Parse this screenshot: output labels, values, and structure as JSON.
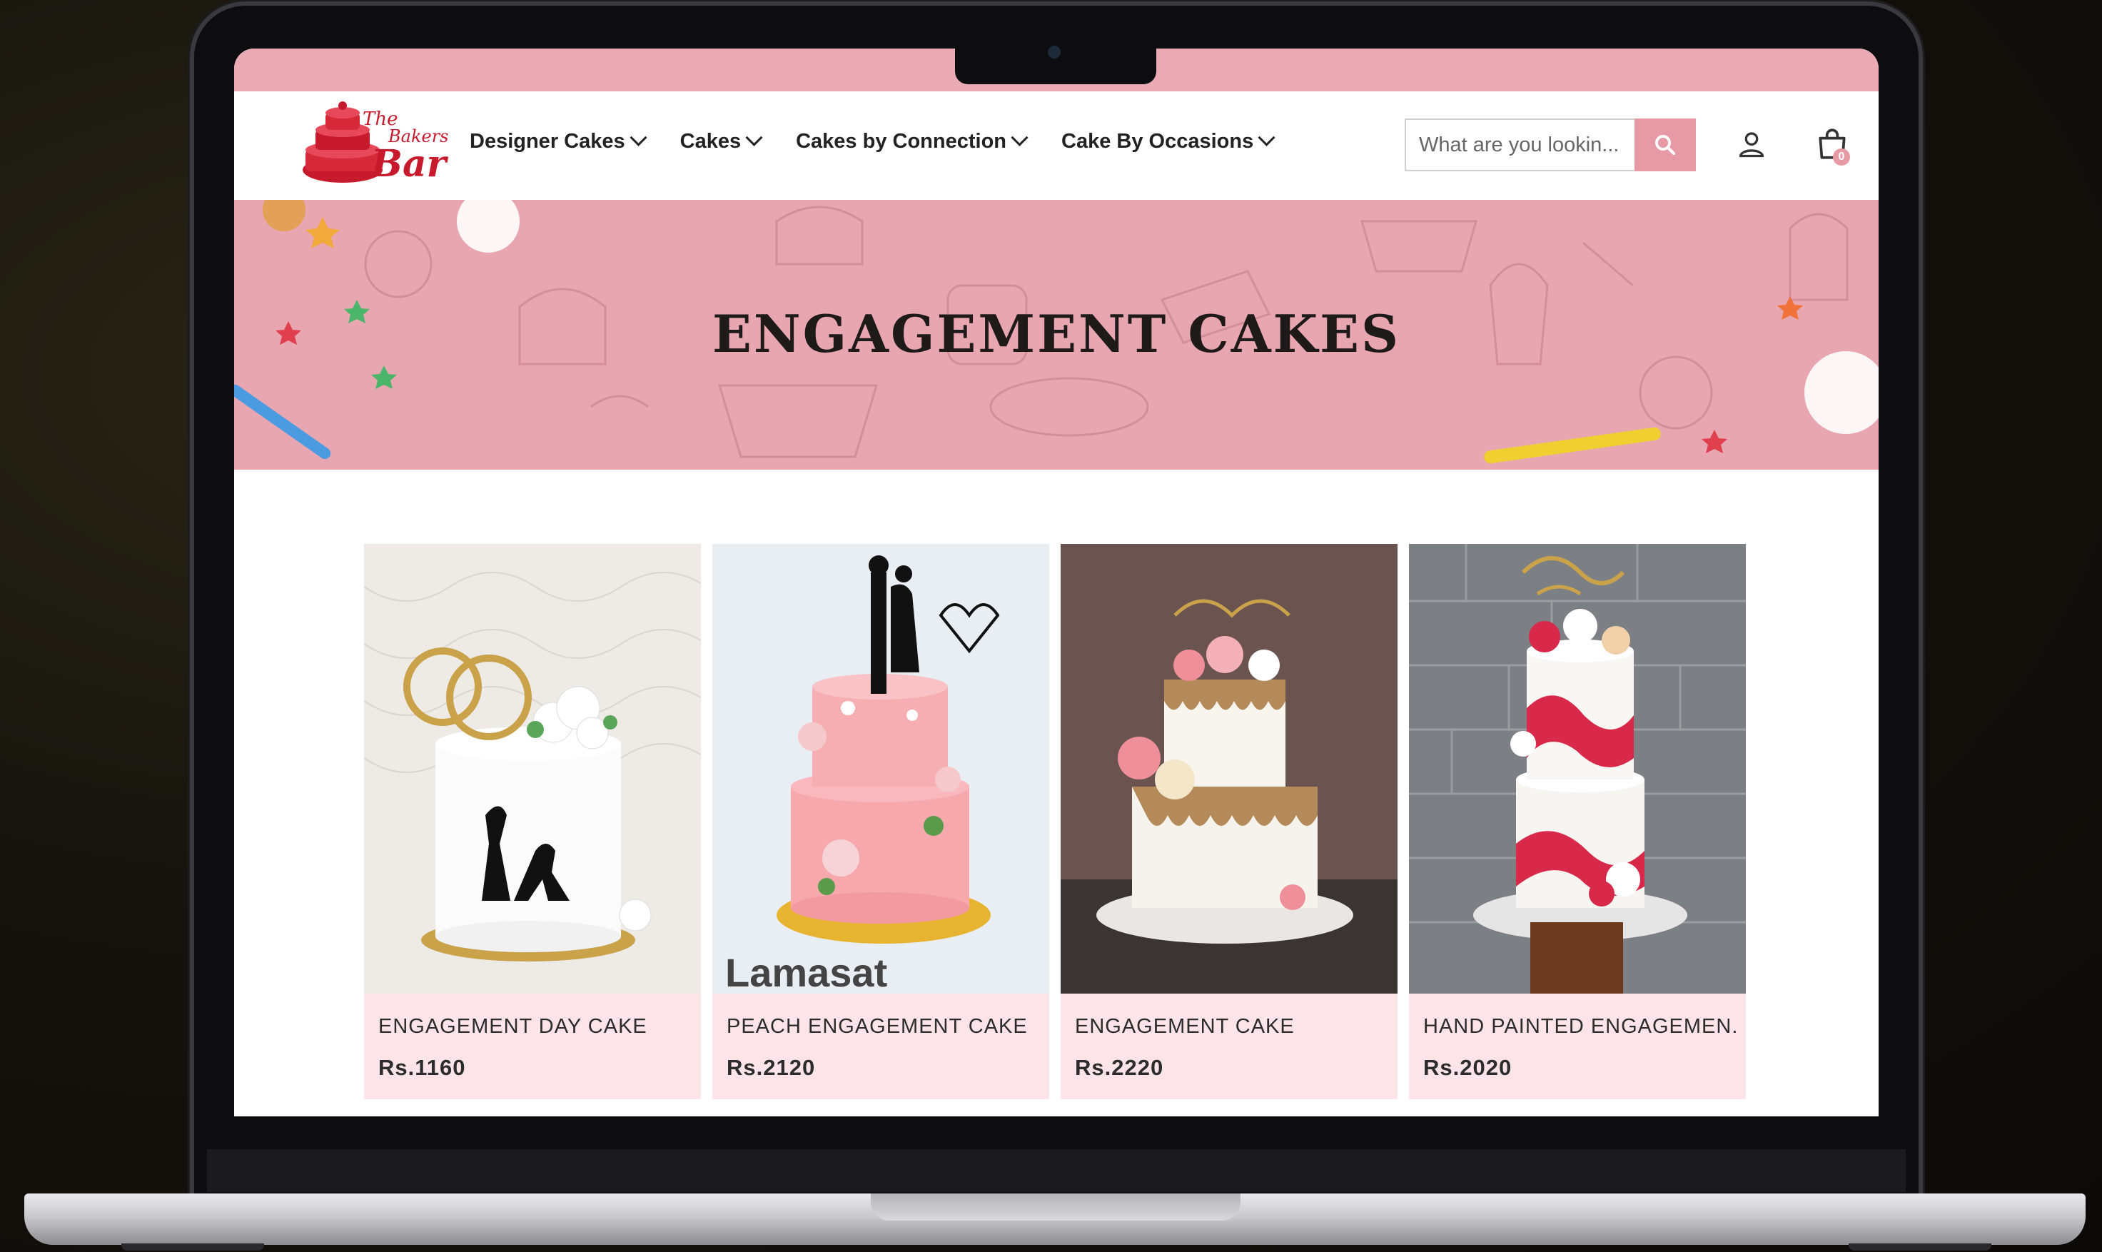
{
  "brand": {
    "logo_line1": "The",
    "logo_line2": "Bakers",
    "logo_line3": "Bar"
  },
  "nav": {
    "items": [
      {
        "label": "Designer Cakes"
      },
      {
        "label": "Cakes"
      },
      {
        "label": "Cakes by Connection"
      },
      {
        "label": "Cake By Occasions"
      }
    ]
  },
  "search": {
    "placeholder": "What are you lookin..."
  },
  "cart": {
    "count": "0"
  },
  "banner": {
    "title": "ENGAGEMENT CAKES"
  },
  "products": [
    {
      "name": "ENGAGEMENT DAY CAKE",
      "price": "Rs.1160",
      "watermark": ""
    },
    {
      "name": "PEACH ENGAGEMENT CAKE",
      "price": "Rs.2120",
      "watermark": "Lamasat"
    },
    {
      "name": "ENGAGEMENT CAKE",
      "price": "Rs.2220",
      "watermark": ""
    },
    {
      "name": "HAND PAINTED ENGAGEMEN...",
      "price": "Rs.2020",
      "watermark": ""
    }
  ],
  "colors": {
    "accent": "#e79aa5",
    "topbar": "#e9aab3",
    "banner": "#e8a6b1",
    "card_bg": "#fde4e8",
    "logo_red": "#c71a2c"
  }
}
